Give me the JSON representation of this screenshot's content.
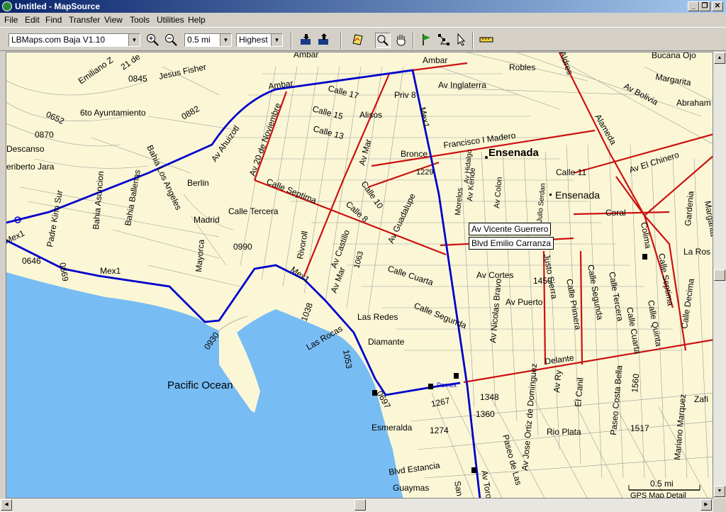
{
  "window": {
    "title": "Untitled - MapSource"
  },
  "menu": [
    "File",
    "Edit",
    "Find",
    "Transfer",
    "View",
    "Tools",
    "Utilities",
    "Help"
  ],
  "toolbar": {
    "map_product": "LBMaps.com Baja V1.10",
    "zoom_scale": "0.5 mi",
    "detail_level": "Highest",
    "icons": [
      "zoom-in-icon",
      "zoom-out-icon",
      "receive-from-device-icon",
      "send-to-device-icon",
      "map-select-icon",
      "zoom-tool-icon",
      "hand-tool-icon",
      "waypoint-flag-icon",
      "route-tool-icon",
      "selection-arrow-icon",
      "measure-distance-icon"
    ]
  },
  "tooltip": {
    "line1": "Av Vicente Guerrero",
    "line2": "Blvd Emilio Carranza"
  },
  "scale": {
    "label": "0.5 mi",
    "detail": "GPS Map Detail"
  },
  "map": {
    "water_label": "Pacific Ocean",
    "city_label": "Ensenada",
    "city_label_2": "Ensenada",
    "labels": [
      "Ambar",
      "Robles",
      "Bucana Ojo",
      "Margarita",
      "Abraham",
      "Av Bolivia",
      "Av Inglaterra",
      "Priv 8",
      "Calle 17",
      "Calle 15",
      "Calle 13",
      "Alisos",
      "Av Mar",
      "Mex1",
      "Francisco I Madero",
      "Bronce",
      "1229",
      "Calle 11",
      "Av Kende",
      "Av Colon",
      "Morelos",
      "Calle Septima",
      "Calle 10",
      "Calle 8",
      "Av Guadalupe",
      "Av 20 de Noviembre",
      "Av Ahuizotl",
      "Ambar",
      "Emiliano Z",
      "21 de",
      "0845",
      "Jesus Fisher",
      "0652",
      "0870",
      "6to Ayuntamiento",
      "0882",
      "Descanso",
      "eriberto Jara",
      "Bahia Asuncion",
      "Bahia Ballenas",
      "Bahia Los Angeles",
      "Berlin",
      "Calle Tercera",
      "Madrid",
      "0990",
      "Mayorca",
      "Rivoroll",
      "Av Castillo",
      "Av Mar",
      "1063",
      "Padre Kino Sur",
      "Mex1",
      "Mex1",
      "0646",
      "0669",
      "Mex1",
      "1038",
      "Las Rocas",
      "1053",
      "0930",
      "Calle Cuarta",
      "Calle Segunda",
      "Las Redes",
      "Diamante",
      "Pemex",
      "0697",
      "1267",
      "Esmeralda",
      "1274",
      "Blvd Estancia",
      "Guaymas",
      "San Fe",
      "Av Toro",
      "Paseo de Las",
      "Av Jose Ortiz de Dominguez",
      "Av Nicolas Bravo",
      "Av Cortes",
      "Av Puerto",
      "1450",
      "Justo Sierra",
      "Calle Primera",
      "Calle Segunda",
      "Calle Tercera",
      "Calle Quinta",
      "Calle Cuarta",
      "Calle Septima",
      "Calle Decima",
      "Calle 11",
      "Coral",
      "Colima",
      "Gardenia",
      "Alameda",
      "Aldres",
      "Av El Chinero",
      "Margarita",
      "La Ros",
      "Delante",
      "1348",
      "1360",
      "Rio Plata",
      "El Canil",
      "Av Ry",
      "Paseo Costa Bella",
      "1560",
      "1517",
      "Mariano Marquez",
      "Zafi",
      "Av Hidalgo",
      "Jullo Serdan"
    ]
  },
  "colors": {
    "land": "#fbf7d6",
    "water": "#78bcf4",
    "main_road": "#0000cc",
    "arterial": "#cc1111",
    "street": "#9a9a9a"
  }
}
